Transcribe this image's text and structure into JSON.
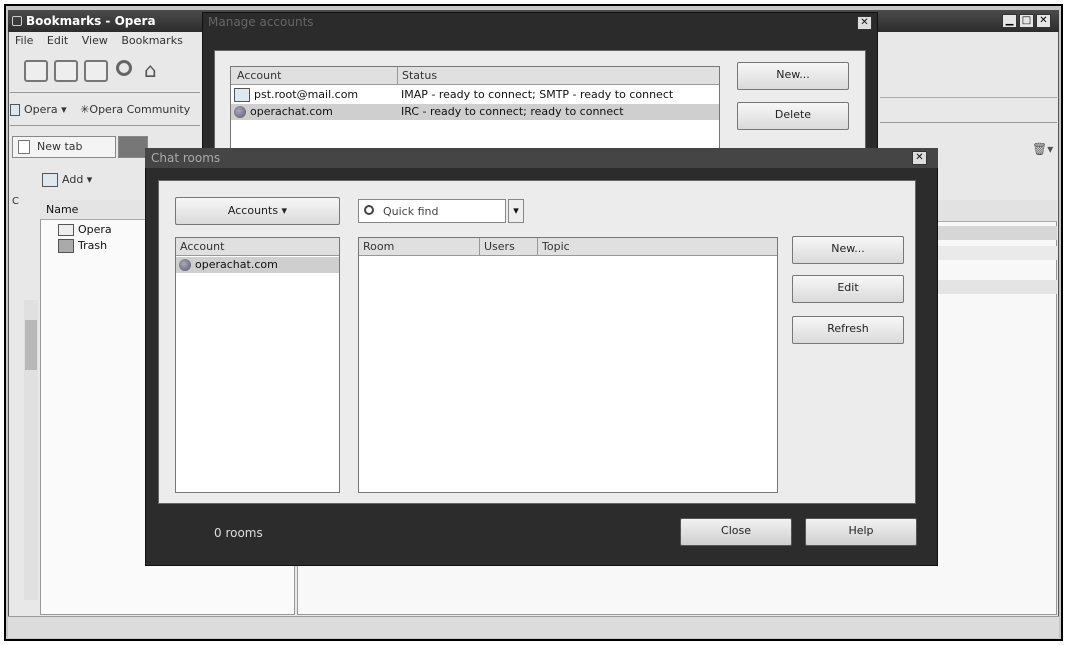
{
  "main_window": {
    "title": "Bookmarks - Opera",
    "menu": [
      "File",
      "Edit",
      "View",
      "Bookmarks"
    ],
    "personal_bar": [
      "Opera",
      "Opera Community"
    ],
    "tab_label": "New tab",
    "add_label": "Add",
    "tree_header": "Name",
    "tree_items": [
      "Opera",
      "Trash"
    ]
  },
  "manage_accounts": {
    "title": "Manage accounts",
    "columns": [
      "Account",
      "Status"
    ],
    "rows": [
      {
        "account": "pst.root@mail.com",
        "status": "IMAP - ready to connect; SMTP - ready to connect"
      },
      {
        "account": "operachat.com",
        "status": "IRC - ready to connect; ready to connect"
      }
    ],
    "new_button": "New...",
    "delete_button": "Delete"
  },
  "chat_rooms": {
    "title": "Chat rooms",
    "account_button": "Accounts",
    "quick_find_placeholder": "Quick find",
    "left_header": "Account",
    "left_items": [
      "operachat.com"
    ],
    "columns": [
      "Room",
      "Users",
      "Topic"
    ],
    "side_buttons": [
      "New...",
      "Edit",
      "Refresh"
    ],
    "status_text": "0 rooms",
    "close_button": "Close",
    "help_button": "Help"
  },
  "colors": {
    "title_dark": "#2c2c2c",
    "dialog_bg": "#ececec",
    "selection": "#cfcfcf"
  }
}
